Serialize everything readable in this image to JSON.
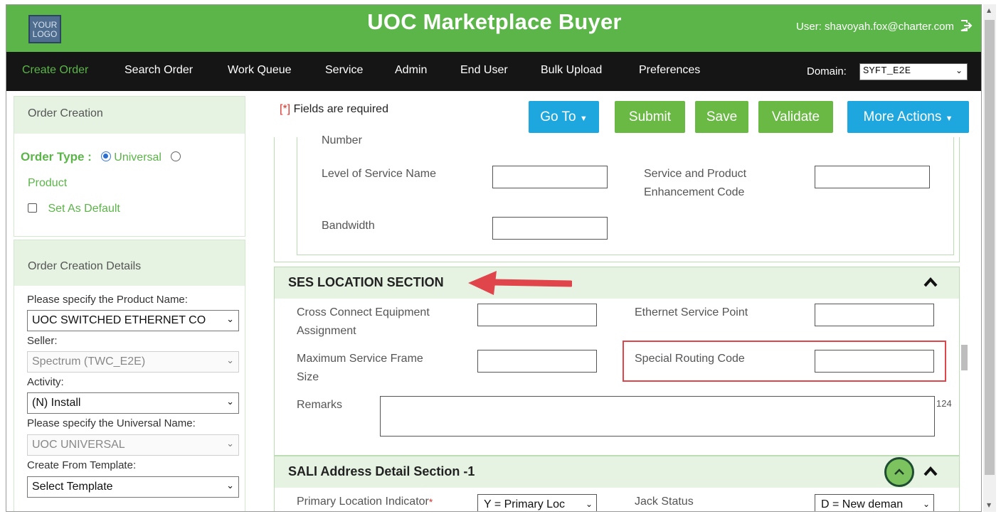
{
  "header": {
    "logo_text": "YOUR LOGO",
    "title": "UOC Marketplace Buyer",
    "user": "User: shavoyah.fox@charter.com"
  },
  "nav": {
    "items": [
      "Create Order",
      "Search Order",
      "Work Queue",
      "Service",
      "Admin",
      "End User",
      "Bulk Upload",
      "Preferences"
    ],
    "domain_label": "Domain:",
    "domain_value": "SYFT_E2E"
  },
  "sidebar": {
    "order_creation_title": "Order Creation",
    "order_type_label": "Order Type :",
    "universal_label": "Universal",
    "product_label": "Product",
    "set_default_label": "Set As Default",
    "details_title": "Order Creation Details",
    "product_name_label": "Please specify the Product Name:",
    "product_name_value": "UOC SWITCHED ETHERNET CO",
    "seller_label": "Seller:",
    "seller_value": "Spectrum (TWC_E2E)",
    "activity_label": "Activity:",
    "activity_value": "(N) Install",
    "universal_name_label": "Please specify the Universal Name:",
    "universal_name_value": "UOC UNIVERSAL",
    "template_label": "Create From Template:",
    "template_value": "Select Template"
  },
  "toolbar": {
    "required_marker": "[*]",
    "required_text": " Fields are required",
    "goto": "Go To",
    "submit": "Submit",
    "save": "Save",
    "validate": "Validate",
    "more_actions": "More Actions"
  },
  "form": {
    "number_label": "Number",
    "level_of_service_label": "Level of Service Name",
    "service_product_enh_label_1": "Service and Product",
    "service_product_enh_label_2": "Enhancement Code",
    "bandwidth_label": "Bandwidth",
    "ses_section_title": "SES LOCATION SECTION",
    "cross_connect_label_1": "Cross Connect Equipment",
    "cross_connect_label_2": "Assignment",
    "ethernet_service_point_label": "Ethernet Service Point",
    "max_frame_label_1": "Maximum Service Frame",
    "max_frame_label_2": "Size",
    "special_routing_label": "Special Routing Code",
    "remarks_label": "Remarks",
    "remarks_count": "124",
    "sali_section_title": "SALI Address Detail Section -1",
    "primary_location_label": "Primary Location Indicator",
    "primary_location_value": "Y = Primary Loc",
    "jack_status_label": "Jack Status",
    "jack_status_value": "D = New deman"
  },
  "colors": {
    "brand_green": "#5bb548",
    "nav_bg": "#151515",
    "button_blue": "#1ea7df",
    "button_green": "#6ab945",
    "annotation_red": "#e0454c"
  }
}
